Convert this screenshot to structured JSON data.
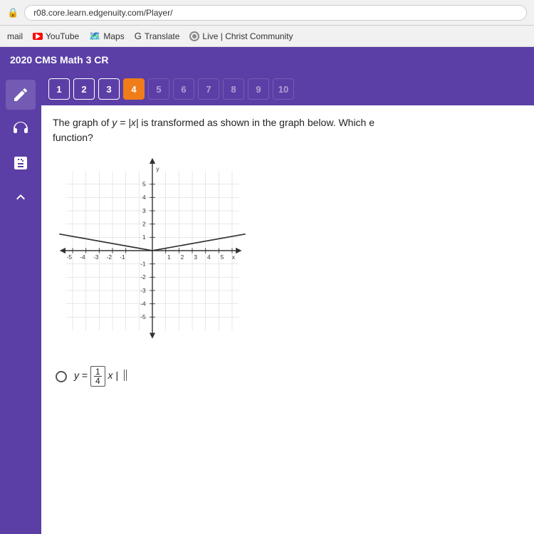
{
  "browser": {
    "url": "r08.core.learn.edgenuity.com/Player/",
    "lock_symbol": "🔒"
  },
  "bookmarks": {
    "mail_label": "mail",
    "youtube_label": "YouTube",
    "maps_label": "Maps",
    "translate_label": "Translate",
    "live_label": "Live | Christ Community"
  },
  "app_header": {
    "title": "2020 CMS Math 3 CR"
  },
  "sidebar": {
    "icons": [
      "pencil",
      "headphones",
      "calculator",
      "arrow-up"
    ]
  },
  "question_tabs": {
    "tabs": [
      {
        "number": "1",
        "state": "outlined"
      },
      {
        "number": "2",
        "state": "outlined"
      },
      {
        "number": "3",
        "state": "outlined"
      },
      {
        "number": "4",
        "state": "active"
      },
      {
        "number": "5",
        "state": "dim"
      },
      {
        "number": "6",
        "state": "dim"
      },
      {
        "number": "7",
        "state": "dim"
      },
      {
        "number": "8",
        "state": "dim"
      },
      {
        "number": "9",
        "state": "dim"
      },
      {
        "number": "10",
        "state": "dim"
      }
    ]
  },
  "question": {
    "text_before": "The graph of ",
    "equation": "y = |x|",
    "text_after": " is transformed as shown in the graph below. Which e",
    "text_line2": "function?",
    "answer_label": "y =",
    "answer_fraction_num": "1",
    "answer_fraction_den": "4",
    "answer_suffix": "x"
  },
  "graph": {
    "x_min": -5,
    "x_max": 5,
    "y_min": -5,
    "y_max": 5,
    "x_labels": [
      "-5",
      "-4",
      "-3",
      "-2",
      "-1",
      "",
      "1",
      "2",
      "3",
      "4",
      "5"
    ],
    "y_labels": [
      "5",
      "4",
      "3",
      "2",
      "1",
      "-1",
      "-2",
      "-3",
      "-4",
      "-5"
    ]
  }
}
